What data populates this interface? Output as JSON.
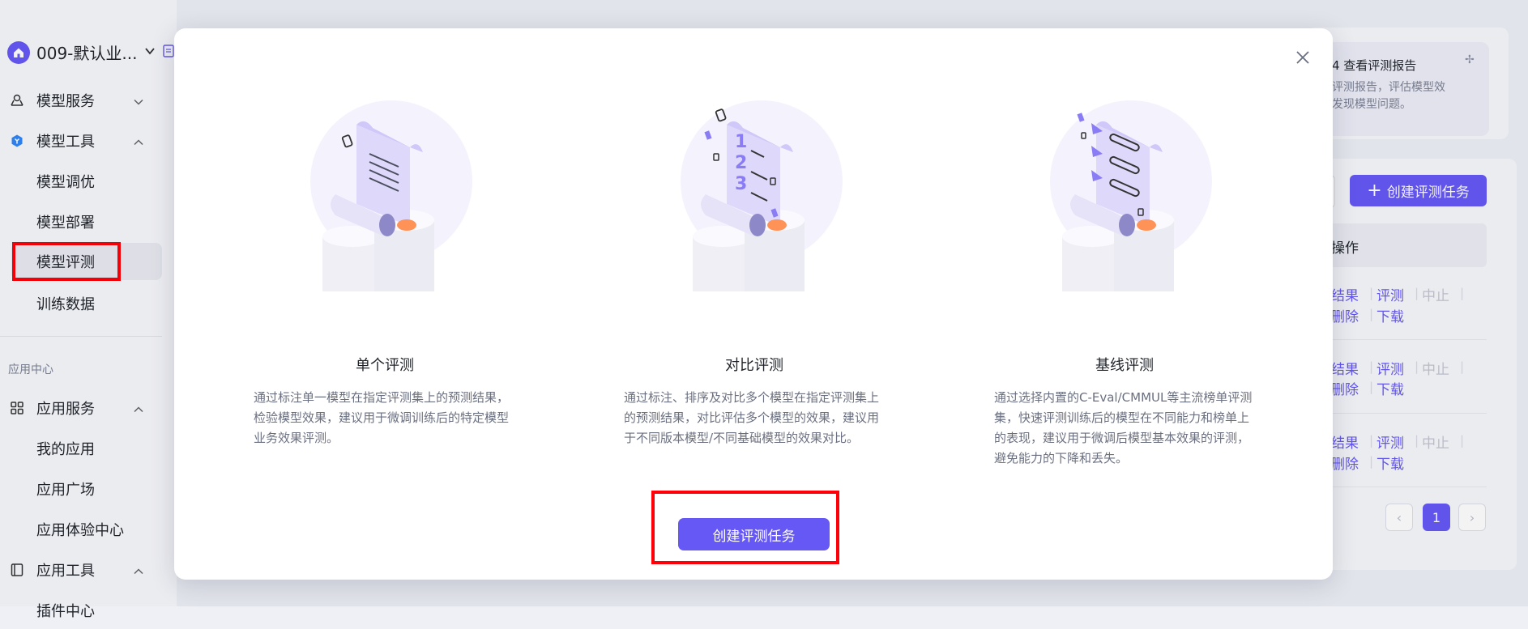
{
  "sidebar": {
    "workspace": "009-默认业...",
    "groups": [
      {
        "label": "模型服务"
      },
      {
        "label": "模型工具"
      }
    ],
    "model_tools_items": [
      "模型调优",
      "模型部署",
      "模型评测",
      "训练数据"
    ],
    "section_label": "应用中心",
    "app_groups": [
      {
        "label": "应用服务"
      },
      {
        "label": "应用工具"
      }
    ],
    "app_service_items": [
      "我的应用",
      "应用广场",
      "应用体验中心"
    ],
    "partial_item": "插件中心"
  },
  "background": {
    "tip_title": "4 查看评测报告",
    "tip_desc": "评测报告，评估模型效发现模型问题。",
    "tip_close": "✢",
    "create_button": "创建评测任务",
    "create_button_icon": "plus-icon",
    "table_header_ops": "操作",
    "rows": [
      {
        "a1": "结果",
        "a2": "评测",
        "a3": "中止",
        "b1": "删除",
        "b2": "下载"
      },
      {
        "a1": "结果",
        "a2": "评测",
        "a3": "中止",
        "b1": "删除",
        "b2": "下载"
      },
      {
        "a1": "结果",
        "a2": "评测",
        "a3": "中止",
        "b1": "删除",
        "b2": "下载"
      }
    ],
    "pagination": {
      "prev": "‹",
      "current": "1",
      "next": "›"
    }
  },
  "modal": {
    "options": [
      {
        "title": "单个评测",
        "desc": "通过标注单一模型在指定评测集上的预测结果，检验模型效果，建议用于微调训练后的特定模型业务效果评测。"
      },
      {
        "title": "对比评测",
        "desc": "通过标注、排序及对比多个模型在指定评测集上的预测结果，对比评估多个模型的效果，建议用于不同版本模型/不同基础模型的效果对比。"
      },
      {
        "title": "基线评测",
        "desc": "通过选择内置的C-Eval/CMMUL等主流榜单评测集，快速评测训练后的模型在不同能力和榜单上的表现，建议用于微调后模型基本效果的评测，避免能力的下降和丢失。"
      }
    ],
    "primary_button": "创建评测任务"
  },
  "colors": {
    "primary": "#6658f5",
    "highlight": "#ff0008"
  }
}
